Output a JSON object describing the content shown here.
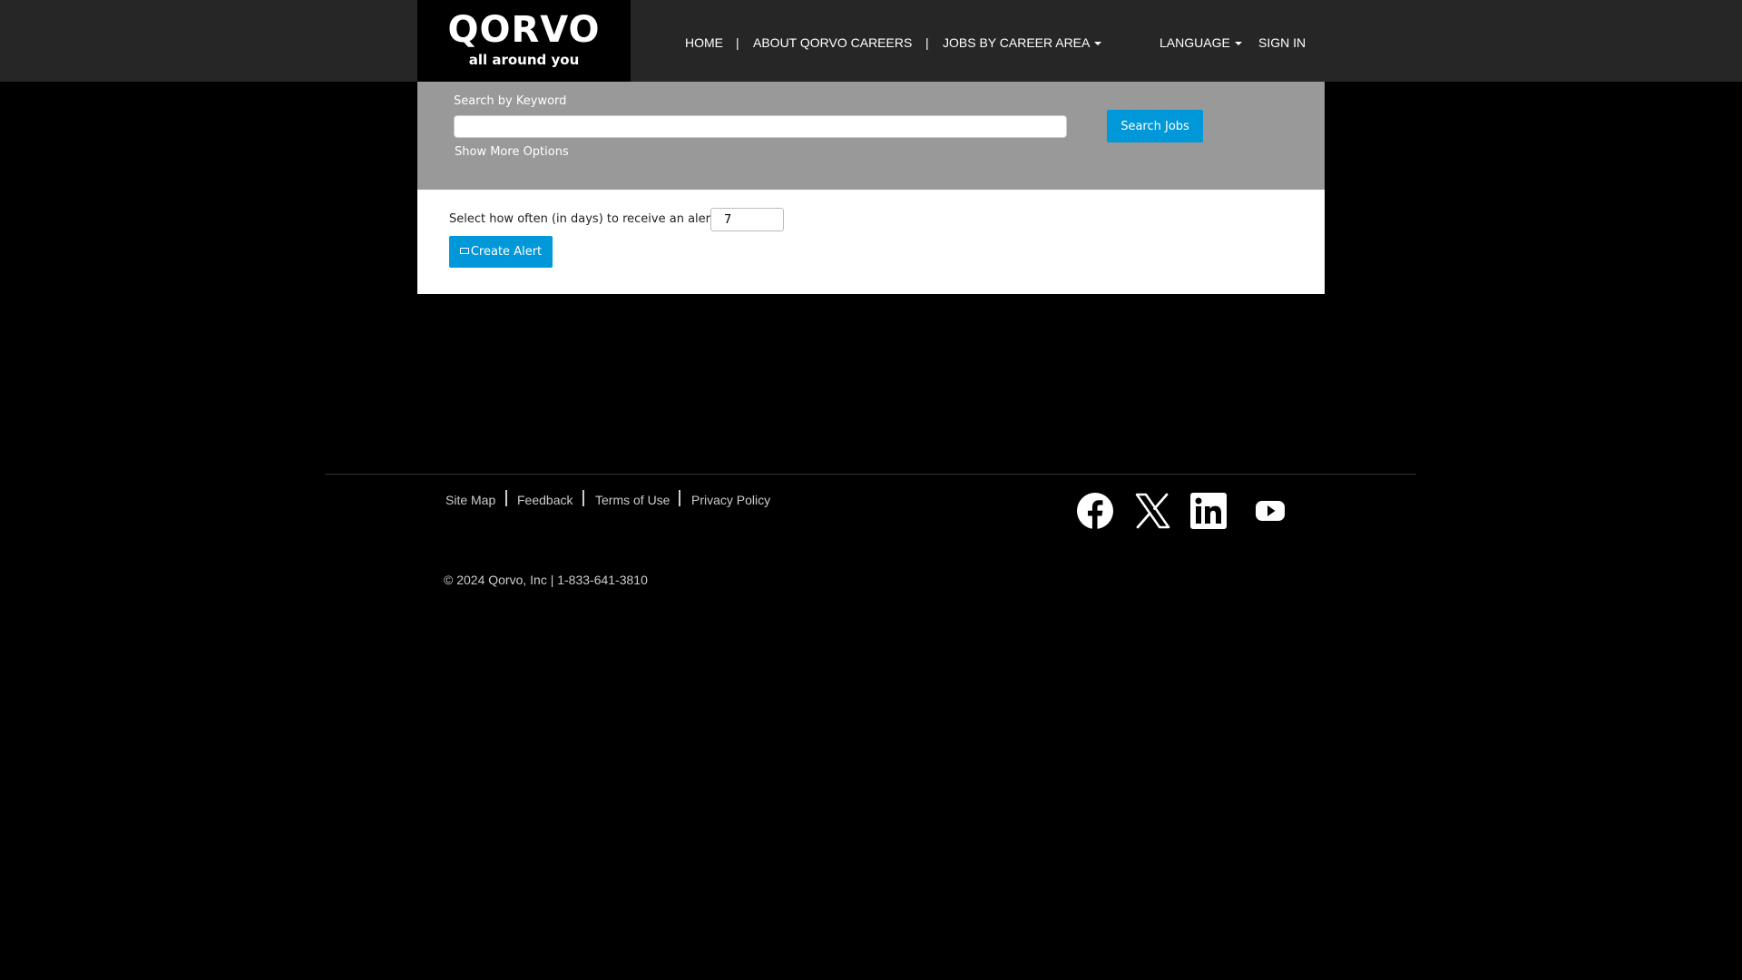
{
  "header": {
    "logo_text": "QORVO",
    "logo_tagline": "all around you",
    "nav": {
      "home": "HOME",
      "about": "ABOUT QORVO CAREERS",
      "jobs_by_area": "JOBS BY CAREER AREA",
      "language": "LANGUAGE",
      "sign_in": "SIGN IN",
      "separator": "|"
    }
  },
  "search": {
    "label": "Search by Keyword",
    "keyword_value": "",
    "more_options": "Show More Options",
    "button_label": "Search Jobs"
  },
  "alert": {
    "label": "Select how often (in days) to receive an alert:",
    "frequency_value": "7",
    "button_label": "Create Alert"
  },
  "footer": {
    "links": {
      "site_map": "Site Map",
      "feedback": "Feedback",
      "terms": "Terms of Use",
      "privacy": "Privacy Policy"
    },
    "social_icons": [
      "facebook-icon",
      "x-icon",
      "linkedin-icon",
      "youtube-icon"
    ],
    "copyright": "© 2024 Qorvo, Inc | 1-833-641-3810"
  },
  "colors": {
    "header_bg": "#262626",
    "search_panel_bg": "#999999",
    "accent_blue": "#0098d8",
    "page_bg": "#000000"
  }
}
